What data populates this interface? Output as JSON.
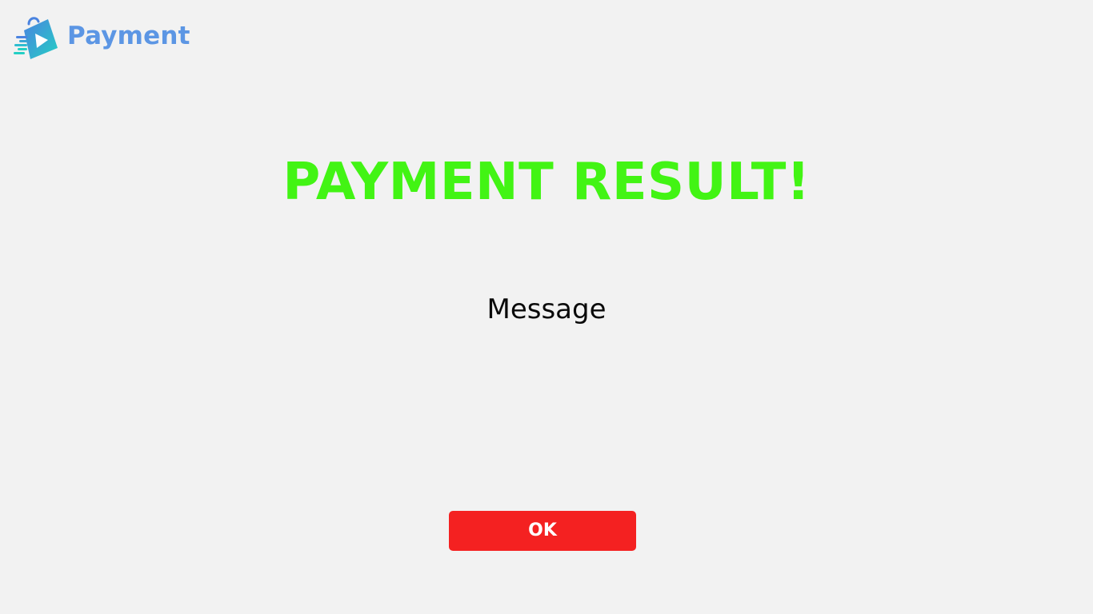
{
  "header": {
    "app_name": "Payment",
    "logo_icon": "shopping-bag-play-icon",
    "brand_color": "#5c96e4"
  },
  "result": {
    "title": "PAYMENT RESULT!",
    "title_color": "#42f414",
    "message": "Message"
  },
  "actions": {
    "ok_label": "OK",
    "ok_color": "#f42121"
  }
}
